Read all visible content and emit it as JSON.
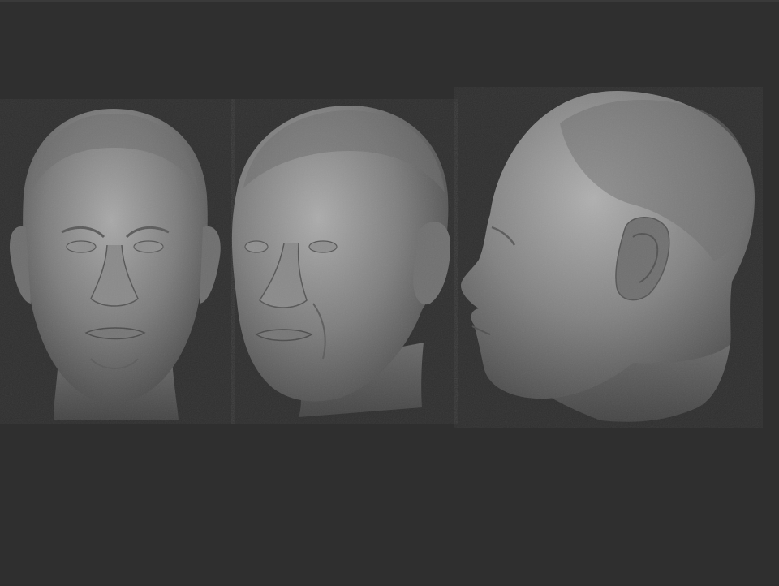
{
  "scene": {
    "background_color": "#2f2f2f",
    "clay_color": "#7b7b7b",
    "views": [
      {
        "view": "front"
      },
      {
        "view": "three-quarter"
      },
      {
        "view": "profile"
      }
    ]
  }
}
